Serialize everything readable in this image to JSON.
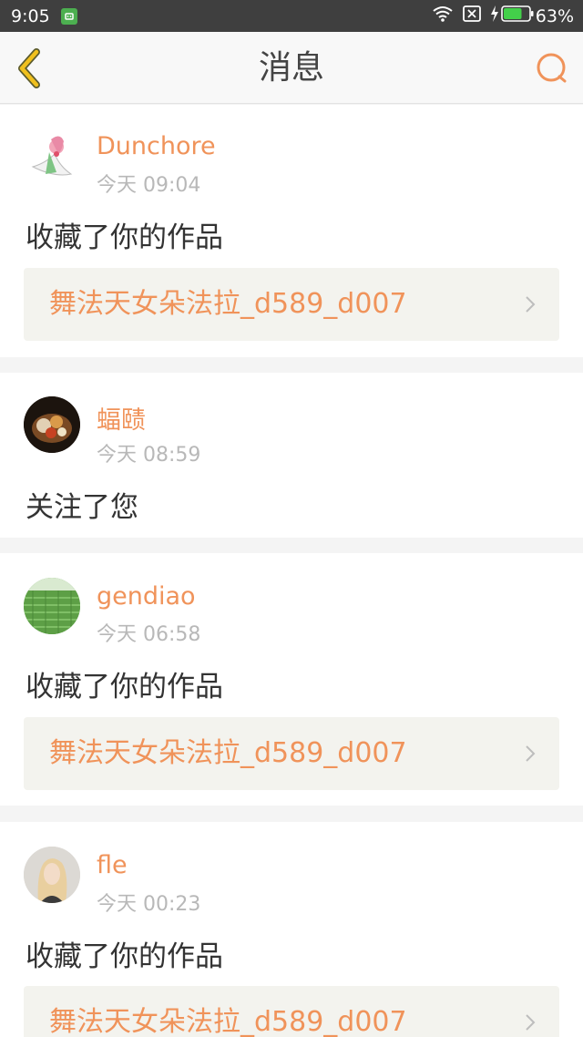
{
  "status_bar": {
    "time": "9:05",
    "battery": "63%"
  },
  "header": {
    "title": "消息"
  },
  "colors": {
    "accent": "#f0935a",
    "back_arrow": "#f0c01e",
    "status_bar_bg": "#3f3f3f",
    "work_link_bg": "#f3f3ee"
  },
  "messages": [
    {
      "username": "Dunchore",
      "time": "今天 09:04",
      "action": "收藏了你的作品",
      "work_title": "舞法天女朵法拉_d589_d007"
    },
    {
      "username": "蝠赜",
      "time": "今天 08:59",
      "action": "关注了您"
    },
    {
      "username": "gendiao",
      "time": "今天 06:58",
      "action": "收藏了你的作品",
      "work_title": "舞法天女朵法拉_d589_d007"
    },
    {
      "username": "fle",
      "time": "今天 00:23",
      "action": "收藏了你的作品",
      "work_title": "舞法天女朵法拉_d589_d007"
    }
  ]
}
